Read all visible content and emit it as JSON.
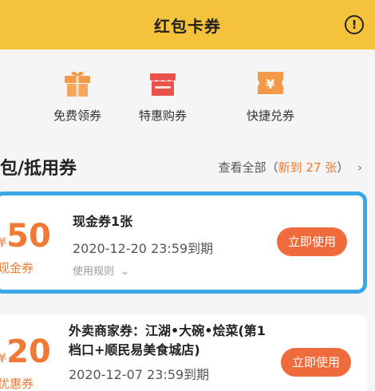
{
  "header": {
    "title": "红包卡券",
    "info_icon": "info-icon"
  },
  "quick_actions": [
    {
      "label": "免费领券",
      "icon": "gift-icon",
      "color": "#f39a4a"
    },
    {
      "label": "特惠购券",
      "icon": "shop-icon",
      "color": "#e9524b"
    },
    {
      "label": "快捷兑券",
      "icon": "yen-ticket-icon",
      "color": "#f39a4a"
    }
  ],
  "section": {
    "title": "包/抵用券",
    "view_all": "查看全部（",
    "new_count": "新到 27 张",
    "view_all_end": "）",
    "chevron": "›"
  },
  "coupons": [
    {
      "currency": "¥",
      "amount": "50",
      "type": "现金券",
      "title": "现金券1张",
      "expire": "2020-12-20 23:59到期",
      "rules": "使用规则",
      "button": "立即使用"
    },
    {
      "currency": "¥",
      "amount": "20",
      "type": "优惠券",
      "title": "外卖商家券：江湖•大碗•烩菜(第1档口+顺民易美食城店)",
      "expire": "2020-12-07 23:59到期",
      "button": "立即使用"
    }
  ],
  "colors": {
    "header_bg": "#f5c33b",
    "accent": "#ef6b3c",
    "highlight_border": "#3aa7e6"
  }
}
